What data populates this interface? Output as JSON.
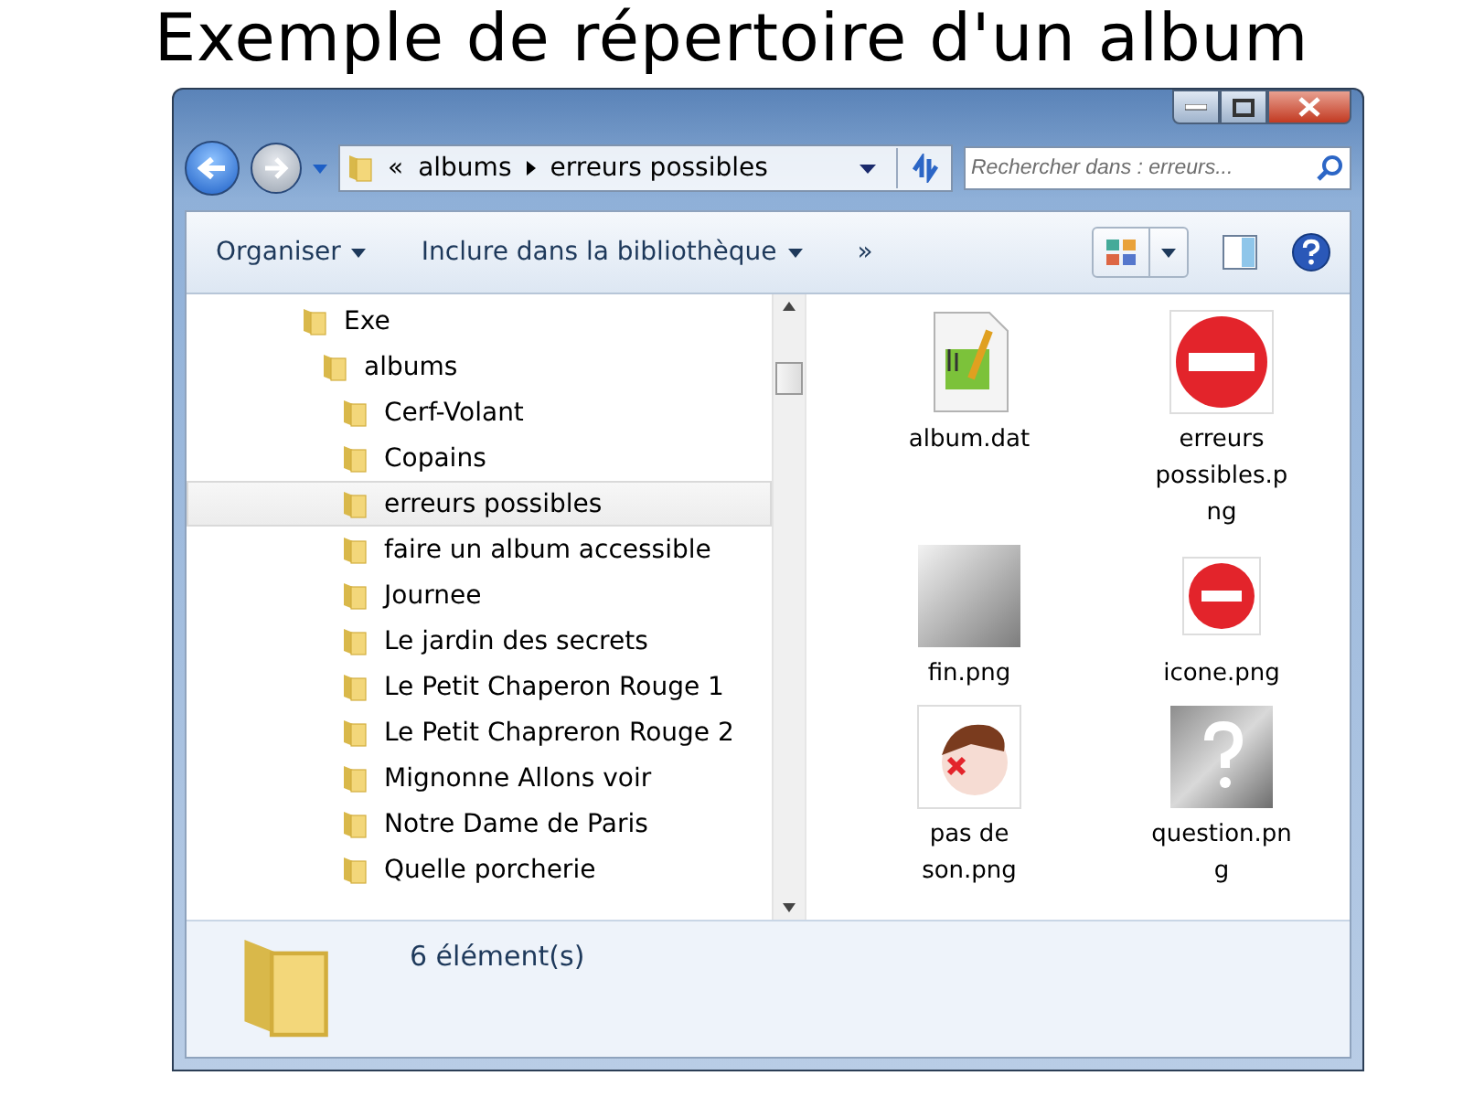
{
  "heading": "Exemple de répertoire d'un album",
  "address": {
    "overflow": "«",
    "segments": [
      "albums",
      "erreurs possibles"
    ]
  },
  "search": {
    "placeholder": "Rechercher dans : erreurs..."
  },
  "toolbar": {
    "items": [
      {
        "label": "Organiser",
        "kind": "menu"
      },
      {
        "label": "Inclure dans la bibliothèque",
        "kind": "menu"
      },
      {
        "label": "»",
        "kind": "more"
      }
    ]
  },
  "tree": [
    {
      "label": "Exe",
      "selected": false,
      "children": [
        {
          "label": "albums",
          "selected": false,
          "children": [
            {
              "label": "Cerf-Volant",
              "selected": false
            },
            {
              "label": "Copains",
              "selected": false
            },
            {
              "label": "erreurs possibles",
              "selected": true
            },
            {
              "label": "faire un album accessible",
              "selected": false
            },
            {
              "label": "Journee",
              "selected": false
            },
            {
              "label": "Le jardin des secrets",
              "selected": false
            },
            {
              "label": "Le Petit Chaperon Rouge 1",
              "selected": false
            },
            {
              "label": "Le Petit Chapreron Rouge 2",
              "selected": false
            },
            {
              "label": "Mignonne Allons voir",
              "selected": false
            },
            {
              "label": "Notre Dame de Paris",
              "selected": false
            },
            {
              "label": "Quelle porcherie",
              "selected": false
            }
          ]
        }
      ]
    }
  ],
  "files": [
    {
      "name": "album.dat",
      "kind": "document"
    },
    {
      "name": "erreurs possibles.png",
      "kind": "sign"
    },
    {
      "name": "fin.png",
      "kind": "fin"
    },
    {
      "name": "icone.png",
      "kind": "no-entry"
    },
    {
      "name": "pas de son.png",
      "kind": "picture"
    },
    {
      "name": "question.png",
      "kind": "question"
    }
  ],
  "status": {
    "count": "6 élément(s)"
  }
}
